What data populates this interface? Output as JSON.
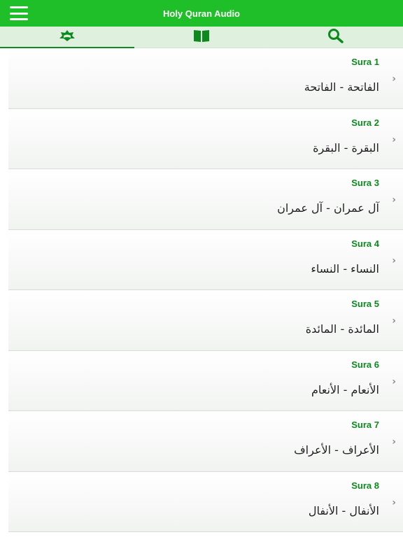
{
  "header": {
    "title": "Holy Quran Audio",
    "menu_icon": "hamburger-menu-icon",
    "color": "#1fbf2a"
  },
  "tabs": [
    {
      "icon": "quran-stand-icon",
      "active": true
    },
    {
      "icon": "open-book-icon",
      "active": false
    },
    {
      "icon": "search-icon",
      "active": false
    }
  ],
  "accent_color": "#0c8a1e",
  "suras": [
    {
      "label": "Sura 1",
      "name": "الفاتحة - الفاتحة"
    },
    {
      "label": "Sura 2",
      "name": "البقرة - البقرة"
    },
    {
      "label": "Sura 3",
      "name": "آل عمران - آل عمران"
    },
    {
      "label": "Sura 4",
      "name": "النساء - النساء"
    },
    {
      "label": "Sura 5",
      "name": "المائدة - المائدة"
    },
    {
      "label": "Sura 6",
      "name": "الأنعام - الأنعام"
    },
    {
      "label": "Sura 7",
      "name": "الأعراف - الأعراف"
    },
    {
      "label": "Sura 8",
      "name": "الأنفال - الأنفال"
    }
  ],
  "row_chevron": "chevron-right-icon"
}
